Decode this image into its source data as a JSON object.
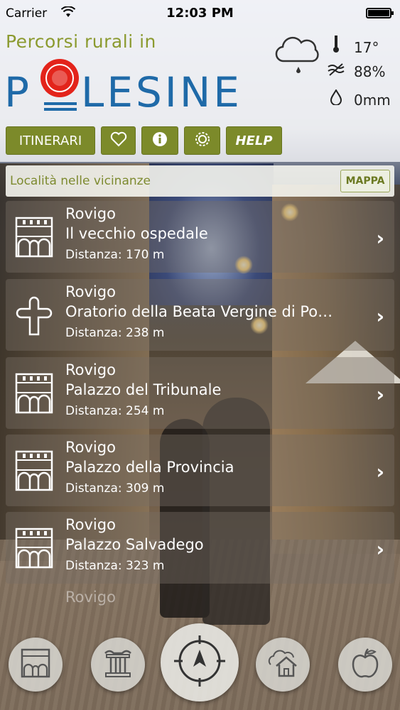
{
  "status_bar": {
    "carrier": "Carrier",
    "time": "12:03 PM"
  },
  "header": {
    "tagline": "Percorsi rurali in",
    "logo_text": "POLESINE"
  },
  "weather": {
    "temperature": "17°",
    "humidity": "88%",
    "rain": "0mm",
    "icons": [
      "cloud-rain-icon",
      "thermometer-icon",
      "humidity-icon",
      "drop-icon"
    ]
  },
  "toolbar": {
    "itinerari_label": "ITINERARI",
    "favorites_icon": "heart-icon",
    "info_icon": "info-icon",
    "settings_icon": "gear-icon",
    "help_label": "HELP"
  },
  "nearby": {
    "label": "Località nelle vicinanze",
    "map_button": "MAPPA"
  },
  "places": [
    {
      "city": "Rovigo",
      "name": "Il vecchio ospedale",
      "distance": "Distanza: 170 m",
      "icon": "palazzo-icon"
    },
    {
      "city": "Rovigo",
      "name": "Oratorio della Beata Vergine di Pom...",
      "distance": "Distanza: 238 m",
      "icon": "cross-icon"
    },
    {
      "city": "Rovigo",
      "name": "Palazzo del Tribunale",
      "distance": "Distanza: 254 m",
      "icon": "palazzo-icon"
    },
    {
      "city": "Rovigo",
      "name": "Palazzo della Provincia",
      "distance": "Distanza: 309 m",
      "icon": "palazzo-icon"
    },
    {
      "city": "Rovigo",
      "name": "Palazzo Salvadego",
      "distance": "Distanza: 323 m",
      "icon": "palazzo-icon"
    }
  ],
  "partial_row_city": "Rovigo",
  "tabs": [
    "palazzo-tab-icon",
    "column-tab-icon",
    "compass-tab-icon",
    "house-tab-icon",
    "apple-tab-icon"
  ],
  "colors": {
    "accent_green": "#7c8a2a",
    "logo_blue": "#1f6aa8",
    "logo_red": "#e3241b"
  }
}
